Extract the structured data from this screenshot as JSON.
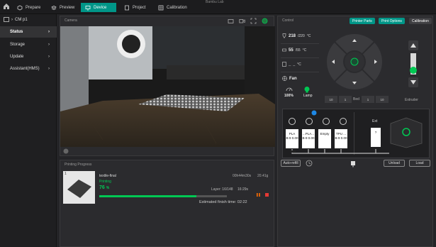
{
  "window": {
    "title": "Bambu Lab"
  },
  "top_tabs": [
    {
      "label": "Prepare",
      "icon": "cube-icon"
    },
    {
      "label": "Preview",
      "icon": "layers-icon"
    },
    {
      "label": "Device",
      "icon": "monitor-icon",
      "active": true
    },
    {
      "label": "Project",
      "icon": "project-icon"
    },
    {
      "label": "Calibration",
      "icon": "calibration-icon"
    }
  ],
  "sidebar": {
    "printer": "CM p1",
    "items": [
      {
        "label": "Status",
        "active": true
      },
      {
        "label": "Storage"
      },
      {
        "label": "Update"
      },
      {
        "label": "Assistant(HMS)"
      }
    ]
  },
  "camera": {
    "title": "Camera"
  },
  "progress": {
    "title": "Printing Progress",
    "plate": "1",
    "job_name": "textile-final",
    "status": "Printing",
    "percent_text": "76",
    "percent_unit": "%",
    "progress_fraction": 0.76,
    "layer_label": "Layer: 16/148",
    "time_left": "16:29s",
    "weight": "20.41g",
    "duration_label": "00h44m30s",
    "estimate_label": "Estimated finish time: 02:22"
  },
  "control": {
    "title": "Control",
    "buttons": {
      "printer_parts": "Printer Parts",
      "print_options": "Print Options",
      "calibration": "Calibration"
    },
    "nozzle": {
      "current": "218",
      "target": "/220",
      "unit": "°C"
    },
    "bed": {
      "current": "55",
      "target": "/55",
      "unit": "°C"
    },
    "chamber": {
      "current": "_",
      "target": "_",
      "unit": "°C"
    },
    "fan_label": "Fan",
    "speed_value": "100%",
    "lamp_label": "Lamp",
    "z_buttons": [
      "10",
      "1",
      "Bed",
      "1",
      "10"
    ],
    "extruder_label": "Extruder"
  },
  "ams": {
    "trays": [
      {
        "name": "PLA",
        "sub": "B-9 0.00"
      },
      {
        "name": "...PLA...",
        "sub": "B-9 0.00"
      },
      {
        "name": "Empty",
        "sub": ""
      },
      {
        "name": "TPU ...",
        "sub": "B-9 0.00"
      }
    ],
    "ext_label": "Ext",
    "ext_slot": "?",
    "auto_refill": "Auto-refill",
    "unload": "Unload",
    "load": "Load"
  },
  "colors": {
    "accent": "#009688",
    "progress": "#00c853",
    "lamp": "#00c853"
  }
}
